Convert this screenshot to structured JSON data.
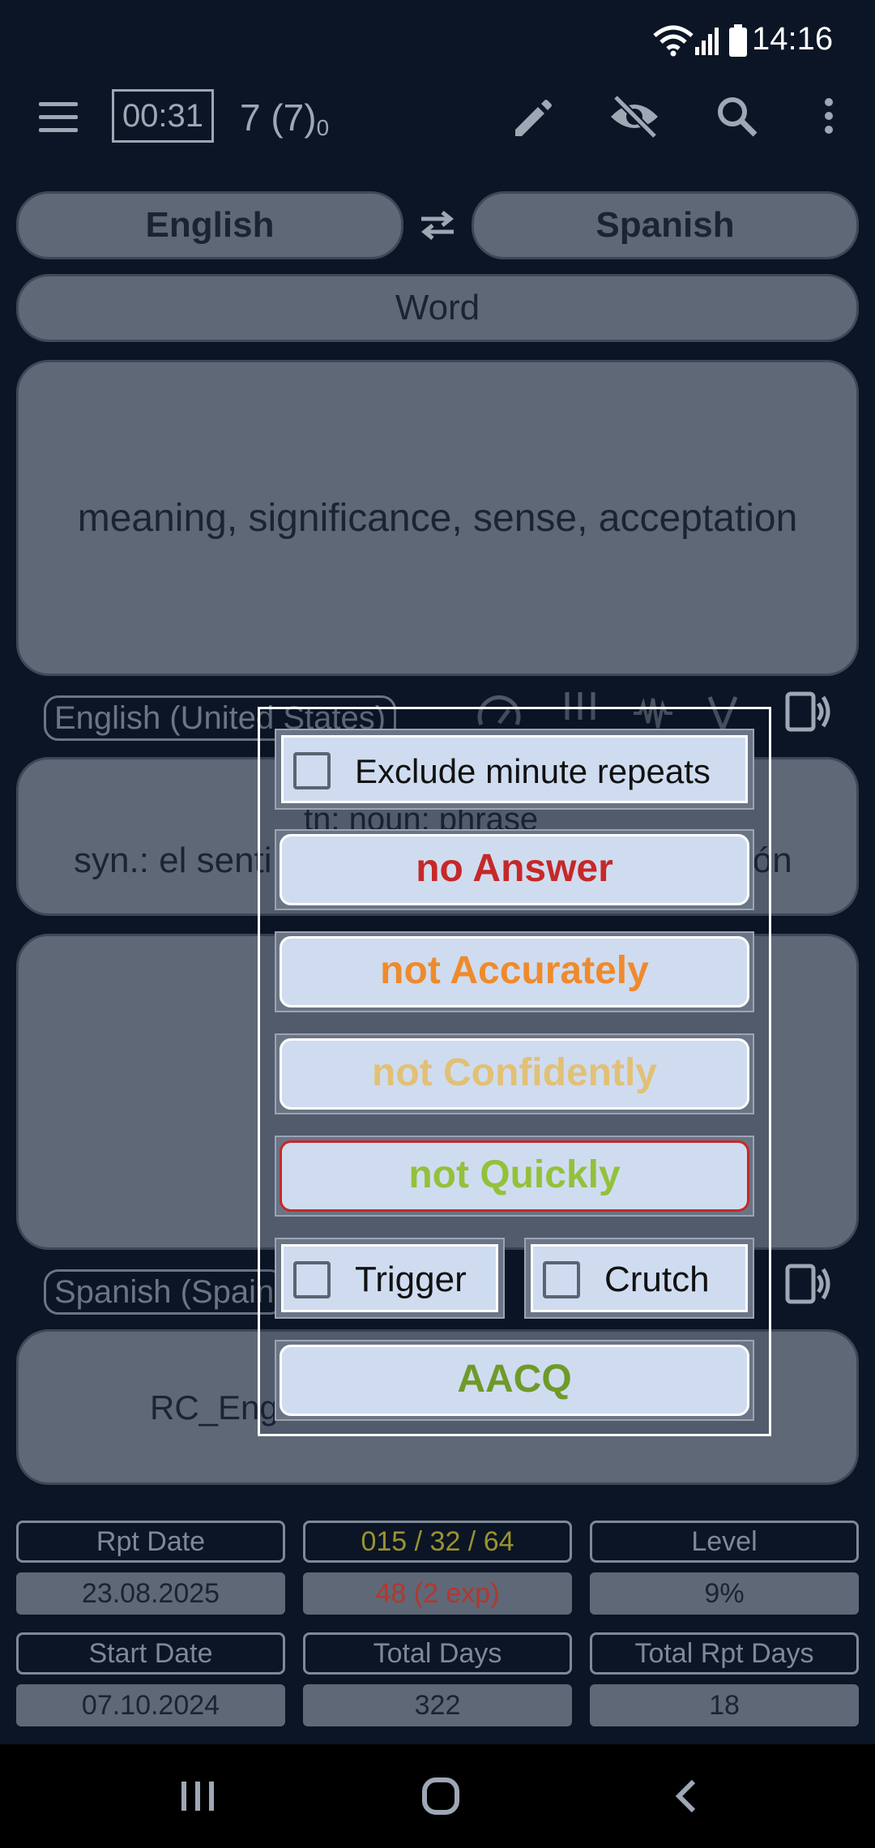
{
  "status_bar": {
    "time": "14:16"
  },
  "toolbar": {
    "timer": "00:31",
    "count": "7 (7)",
    "count_sub": "0"
  },
  "languages": {
    "source": "English",
    "target": "Spanish",
    "swap_icon": "swap-icon"
  },
  "card_type": "Word",
  "question": {
    "text": "meaning, significance, sense, acceptation"
  },
  "source_locale": "English (United States)",
  "synonyms": {
    "pos_line": "tn: noun: phrase",
    "syn_left": "syn.: el senti",
    "syn_right": "ión"
  },
  "target_locale": "Spanish (Spain",
  "deck_line": {
    "left": "RC_Engli",
    "right": ""
  },
  "stats": {
    "rpt_date_label": "Rpt Date",
    "rpt_date": "23.08.2025",
    "intervals_label": "015 / 32 / 64",
    "due": "48 (2 exp)",
    "level_label": "Level",
    "level": "9%",
    "start_date_label": "Start Date",
    "start_date": "07.10.2024",
    "total_days_label": "Total Days",
    "total_days": "322",
    "total_rpt_days_label": "Total Rpt Days",
    "total_rpt_days": "18"
  },
  "dialog": {
    "exclude_label": "Exclude minute repeats",
    "no_answer": "no Answer",
    "not_accurately": "not Accurately",
    "not_confidently": "not Confidently",
    "not_quickly": "not Quickly",
    "trigger_label": "Trigger",
    "crutch_label": "Crutch",
    "aacq": "AACQ"
  },
  "colors": {
    "no_answer": "#c62828",
    "not_accurately": "#ef8a2c",
    "not_confidently": "#e2c075",
    "not_quickly": "#93c13b",
    "aacq": "#6f9a2a",
    "intervals": "#9a9330",
    "due": "#b3372f"
  }
}
